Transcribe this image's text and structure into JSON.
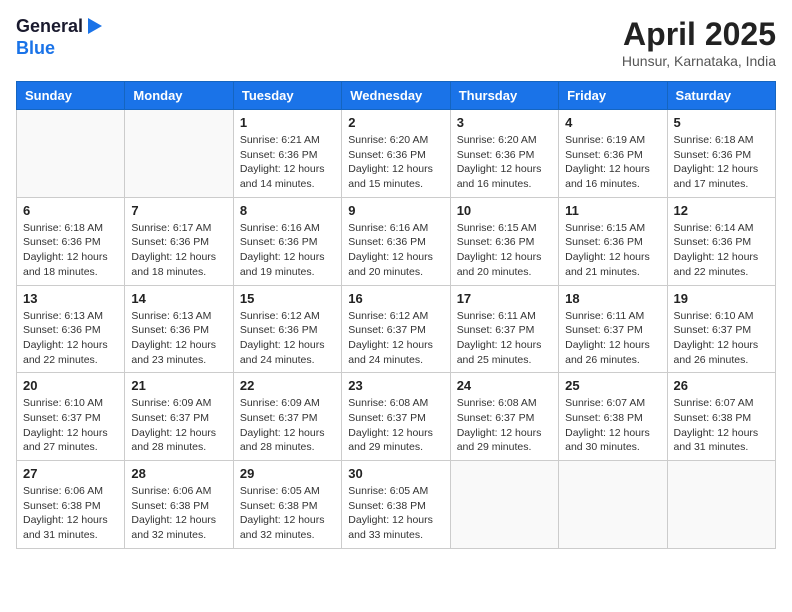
{
  "logo": {
    "line1": "General",
    "line2": "Blue"
  },
  "title": "April 2025",
  "location": "Hunsur, Karnataka, India",
  "weekdays": [
    "Sunday",
    "Monday",
    "Tuesday",
    "Wednesday",
    "Thursday",
    "Friday",
    "Saturday"
  ],
  "weeks": [
    [
      {
        "day": "",
        "info": ""
      },
      {
        "day": "",
        "info": ""
      },
      {
        "day": "1",
        "info": "Sunrise: 6:21 AM\nSunset: 6:36 PM\nDaylight: 12 hours and 14 minutes."
      },
      {
        "day": "2",
        "info": "Sunrise: 6:20 AM\nSunset: 6:36 PM\nDaylight: 12 hours and 15 minutes."
      },
      {
        "day": "3",
        "info": "Sunrise: 6:20 AM\nSunset: 6:36 PM\nDaylight: 12 hours and 16 minutes."
      },
      {
        "day": "4",
        "info": "Sunrise: 6:19 AM\nSunset: 6:36 PM\nDaylight: 12 hours and 16 minutes."
      },
      {
        "day": "5",
        "info": "Sunrise: 6:18 AM\nSunset: 6:36 PM\nDaylight: 12 hours and 17 minutes."
      }
    ],
    [
      {
        "day": "6",
        "info": "Sunrise: 6:18 AM\nSunset: 6:36 PM\nDaylight: 12 hours and 18 minutes."
      },
      {
        "day": "7",
        "info": "Sunrise: 6:17 AM\nSunset: 6:36 PM\nDaylight: 12 hours and 18 minutes."
      },
      {
        "day": "8",
        "info": "Sunrise: 6:16 AM\nSunset: 6:36 PM\nDaylight: 12 hours and 19 minutes."
      },
      {
        "day": "9",
        "info": "Sunrise: 6:16 AM\nSunset: 6:36 PM\nDaylight: 12 hours and 20 minutes."
      },
      {
        "day": "10",
        "info": "Sunrise: 6:15 AM\nSunset: 6:36 PM\nDaylight: 12 hours and 20 minutes."
      },
      {
        "day": "11",
        "info": "Sunrise: 6:15 AM\nSunset: 6:36 PM\nDaylight: 12 hours and 21 minutes."
      },
      {
        "day": "12",
        "info": "Sunrise: 6:14 AM\nSunset: 6:36 PM\nDaylight: 12 hours and 22 minutes."
      }
    ],
    [
      {
        "day": "13",
        "info": "Sunrise: 6:13 AM\nSunset: 6:36 PM\nDaylight: 12 hours and 22 minutes."
      },
      {
        "day": "14",
        "info": "Sunrise: 6:13 AM\nSunset: 6:36 PM\nDaylight: 12 hours and 23 minutes."
      },
      {
        "day": "15",
        "info": "Sunrise: 6:12 AM\nSunset: 6:36 PM\nDaylight: 12 hours and 24 minutes."
      },
      {
        "day": "16",
        "info": "Sunrise: 6:12 AM\nSunset: 6:37 PM\nDaylight: 12 hours and 24 minutes."
      },
      {
        "day": "17",
        "info": "Sunrise: 6:11 AM\nSunset: 6:37 PM\nDaylight: 12 hours and 25 minutes."
      },
      {
        "day": "18",
        "info": "Sunrise: 6:11 AM\nSunset: 6:37 PM\nDaylight: 12 hours and 26 minutes."
      },
      {
        "day": "19",
        "info": "Sunrise: 6:10 AM\nSunset: 6:37 PM\nDaylight: 12 hours and 26 minutes."
      }
    ],
    [
      {
        "day": "20",
        "info": "Sunrise: 6:10 AM\nSunset: 6:37 PM\nDaylight: 12 hours and 27 minutes."
      },
      {
        "day": "21",
        "info": "Sunrise: 6:09 AM\nSunset: 6:37 PM\nDaylight: 12 hours and 28 minutes."
      },
      {
        "day": "22",
        "info": "Sunrise: 6:09 AM\nSunset: 6:37 PM\nDaylight: 12 hours and 28 minutes."
      },
      {
        "day": "23",
        "info": "Sunrise: 6:08 AM\nSunset: 6:37 PM\nDaylight: 12 hours and 29 minutes."
      },
      {
        "day": "24",
        "info": "Sunrise: 6:08 AM\nSunset: 6:37 PM\nDaylight: 12 hours and 29 minutes."
      },
      {
        "day": "25",
        "info": "Sunrise: 6:07 AM\nSunset: 6:38 PM\nDaylight: 12 hours and 30 minutes."
      },
      {
        "day": "26",
        "info": "Sunrise: 6:07 AM\nSunset: 6:38 PM\nDaylight: 12 hours and 31 minutes."
      }
    ],
    [
      {
        "day": "27",
        "info": "Sunrise: 6:06 AM\nSunset: 6:38 PM\nDaylight: 12 hours and 31 minutes."
      },
      {
        "day": "28",
        "info": "Sunrise: 6:06 AM\nSunset: 6:38 PM\nDaylight: 12 hours and 32 minutes."
      },
      {
        "day": "29",
        "info": "Sunrise: 6:05 AM\nSunset: 6:38 PM\nDaylight: 12 hours and 32 minutes."
      },
      {
        "day": "30",
        "info": "Sunrise: 6:05 AM\nSunset: 6:38 PM\nDaylight: 12 hours and 33 minutes."
      },
      {
        "day": "",
        "info": ""
      },
      {
        "day": "",
        "info": ""
      },
      {
        "day": "",
        "info": ""
      }
    ]
  ]
}
